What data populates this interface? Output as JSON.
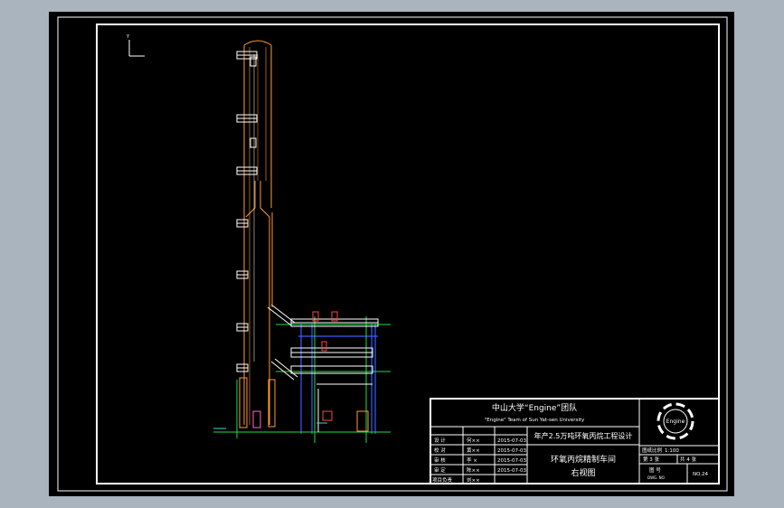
{
  "title_block": {
    "org_cn": "中山大学“Engine”团队",
    "org_en": "\"Engine\" Team of Sun Yat-sen University",
    "project": "年产2.5万吨环氧丙烷工程设计",
    "drawing_title": "环氧丙烷精制车间",
    "view_name": "右视图",
    "logo_text": "Engine",
    "roles": [
      {
        "role": "设 计",
        "name": "何××",
        "date": "2015-07-03"
      },
      {
        "role": "校 对",
        "name": "黄××",
        "date": "2015-07-03"
      },
      {
        "role": "审 核",
        "name": "李 ×",
        "date": "2015-07-03"
      },
      {
        "role": "审 定",
        "name": "陈××",
        "date": "2015-07-03"
      },
      {
        "role": "项目负责",
        "name": "刘××",
        "date": ""
      }
    ],
    "scale_label": "图纸比例",
    "scale_value": "1:100",
    "sheet_label": "第 3 张",
    "total_label": "共 4 张",
    "drawing_no_label": "图 号",
    "drawing_no_sub": "DWG. NO.",
    "drawing_no_value": "NO.24"
  },
  "ucs_label": "Y"
}
